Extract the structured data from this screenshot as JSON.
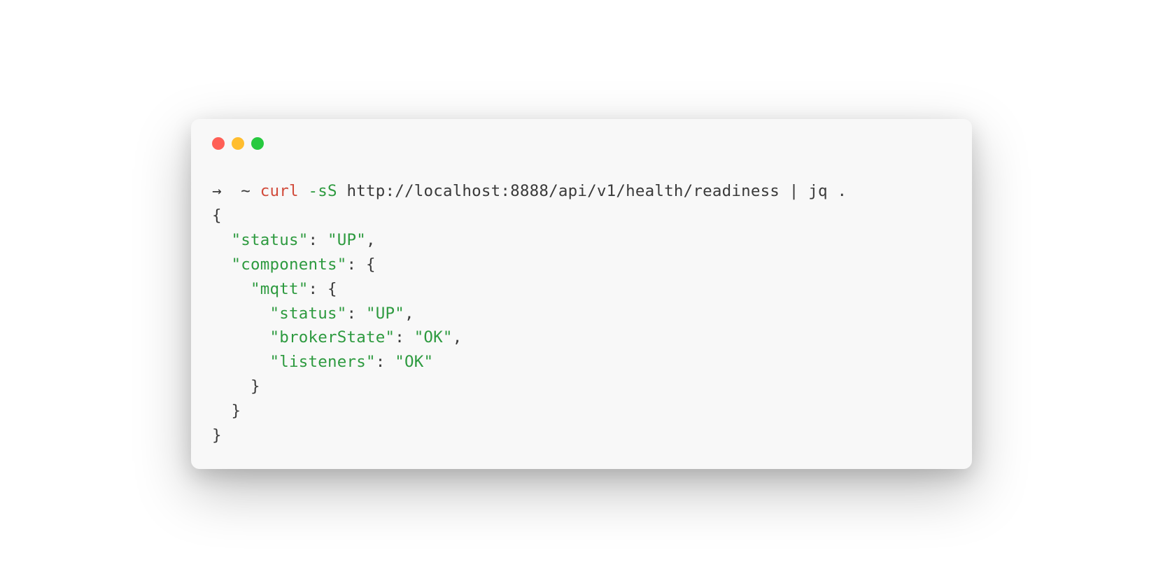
{
  "window": {
    "traffic_colors": {
      "close": "#ff5f56",
      "minimize": "#ffbd2e",
      "zoom": "#27c93f"
    }
  },
  "tokens": [
    {
      "t": "→  ~ ",
      "c": "default"
    },
    {
      "t": "curl",
      "c": "cmd"
    },
    {
      "t": " ",
      "c": "default"
    },
    {
      "t": "-sS",
      "c": "flag"
    },
    {
      "t": " http://localhost:8888/api/v1/health/readiness | jq .",
      "c": "default"
    },
    {
      "t": "\n{",
      "c": "default"
    },
    {
      "t": "\n  ",
      "c": "default"
    },
    {
      "t": "\"status\"",
      "c": "string"
    },
    {
      "t": ": ",
      "c": "default"
    },
    {
      "t": "\"UP\"",
      "c": "string"
    },
    {
      "t": ",",
      "c": "default"
    },
    {
      "t": "\n  ",
      "c": "default"
    },
    {
      "t": "\"components\"",
      "c": "string"
    },
    {
      "t": ": {",
      "c": "default"
    },
    {
      "t": "\n    ",
      "c": "default"
    },
    {
      "t": "\"mqtt\"",
      "c": "string"
    },
    {
      "t": ": {",
      "c": "default"
    },
    {
      "t": "\n      ",
      "c": "default"
    },
    {
      "t": "\"status\"",
      "c": "string"
    },
    {
      "t": ": ",
      "c": "default"
    },
    {
      "t": "\"UP\"",
      "c": "string"
    },
    {
      "t": ",",
      "c": "default"
    },
    {
      "t": "\n      ",
      "c": "default"
    },
    {
      "t": "\"brokerState\"",
      "c": "string"
    },
    {
      "t": ": ",
      "c": "default"
    },
    {
      "t": "\"OK\"",
      "c": "string"
    },
    {
      "t": ",",
      "c": "default"
    },
    {
      "t": "\n      ",
      "c": "default"
    },
    {
      "t": "\"listeners\"",
      "c": "string"
    },
    {
      "t": ": ",
      "c": "default"
    },
    {
      "t": "\"OK\"",
      "c": "string"
    },
    {
      "t": "\n    }",
      "c": "default"
    },
    {
      "t": "\n  }",
      "c": "default"
    },
    {
      "t": "\n}",
      "c": "default"
    }
  ]
}
